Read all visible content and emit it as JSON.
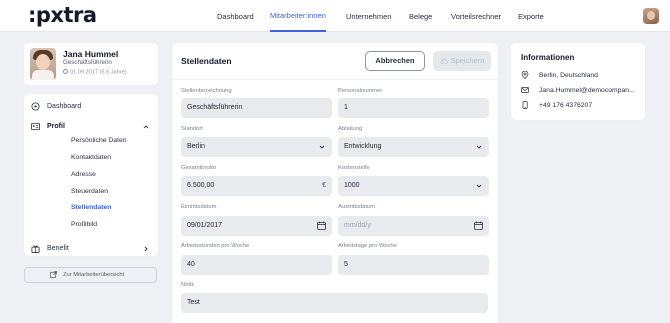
{
  "header": {
    "logo": ":pxtra",
    "nav": [
      "Dashboard",
      "Mitarbeiter:innen",
      "Unternehmen",
      "Belege",
      "Vorteilsrechner",
      "Exporte"
    ],
    "active_nav": "Mitarbeiter:innen"
  },
  "profile": {
    "name": "Jana Hummel",
    "role": "Geschäftsführerin",
    "since": "01.09.2017 (5,5 Jahre)"
  },
  "sidebar": {
    "dashboard": "Dashboard",
    "profil": "Profil",
    "profil_items": [
      "Persönliche Daten",
      "Kontaktdaten",
      "Adresse",
      "Steuerdaten",
      "Stellendaten",
      "Profilbild"
    ],
    "active_item": "Stellendaten",
    "benefit": "Benefit",
    "back": "Zur Mitarbeiterübersicht"
  },
  "form": {
    "title": "Stellendaten",
    "cancel": "Abbrechen",
    "save": "Speichern",
    "fields": {
      "stellenbezeichnung": {
        "label": "Stellenbezeichnung",
        "value": "Geschäftsführerin"
      },
      "personalnummer": {
        "label": "Personalnummer",
        "value": "1"
      },
      "standort": {
        "label": "Standort",
        "value": "Berlin"
      },
      "abteilung": {
        "label": "Abteilung",
        "value": "Entwicklung"
      },
      "gesamtbrutto": {
        "label": "Gesamtbrutto",
        "value": "6.500,00",
        "suffix": "€"
      },
      "kostenstelle": {
        "label": "Kostenstelle",
        "value": "1000"
      },
      "eintrittsdatum": {
        "label": "Eintrittsdatum",
        "value": "09/01/2017"
      },
      "austrittsdatum": {
        "label": "Austrittsdatum",
        "placeholder": "mm/dd/y"
      },
      "arbeitsstunden": {
        "label": "Arbeitsstunden pro Woche",
        "value": "40"
      },
      "arbeitstage": {
        "label": "Arbeitstage pro Woche",
        "value": "5"
      },
      "notiz": {
        "label": "Notiz",
        "value": "Test"
      }
    }
  },
  "info": {
    "title": "Informationen",
    "location": "Berlin, Deutschland",
    "email": "Jana.Hummel@democompan...",
    "phone": "+49 176 4376207"
  },
  "colors": {
    "accent": "#3f63d8",
    "bg": "#eef0f3",
    "field": "#e8eaee"
  }
}
